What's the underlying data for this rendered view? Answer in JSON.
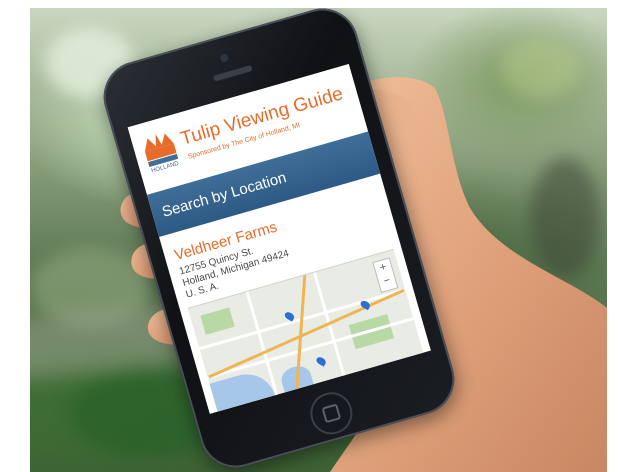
{
  "app": {
    "title": "Tulip Viewing Guide",
    "sponsor": "Sponsored by The City of Holland, MI",
    "logo_text": "HOLLAND"
  },
  "search": {
    "label": "Search by Location"
  },
  "location": {
    "name": "Veldheer Farms",
    "address_lines": [
      "12755 Quincy St.",
      "Holland, Michigan 49424",
      "U. S. A."
    ]
  },
  "map": {
    "zoom_in_label": "+",
    "zoom_out_label": "−",
    "pin_icon": "map-pin-icon"
  },
  "colors": {
    "accent": "#e96b2a",
    "search_bar": "#2d5a84",
    "map_pin": "#2b6fd6"
  }
}
